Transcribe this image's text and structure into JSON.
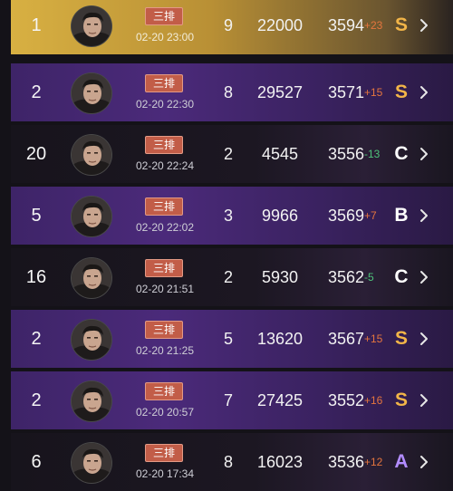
{
  "colors": {
    "delta_up": "#e4753e",
    "delta_down": "#4ec27a",
    "grade_S": "#f2b548",
    "grade_C": "#ffffff",
    "grade_B": "#ffffff",
    "grade_A": "#b28cff"
  },
  "rows": [
    {
      "rank": "1",
      "mode": "三排",
      "time": "02-20 23:00",
      "placement": "9",
      "score": "22000",
      "rating": "3594",
      "delta": "+23",
      "delta_sign": "up",
      "grade": "S",
      "style": "gold"
    },
    {
      "rank": "2",
      "mode": "三排",
      "time": "02-20 22:30",
      "placement": "8",
      "score": "29527",
      "rating": "3571",
      "delta": "+15",
      "delta_sign": "up",
      "grade": "S",
      "style": "purple"
    },
    {
      "rank": "20",
      "mode": "三排",
      "time": "02-20 22:24",
      "placement": "2",
      "score": "4545",
      "rating": "3556",
      "delta": "-13",
      "delta_sign": "down",
      "grade": "C",
      "style": "dark"
    },
    {
      "rank": "5",
      "mode": "三排",
      "time": "02-20 22:02",
      "placement": "3",
      "score": "9966",
      "rating": "3569",
      "delta": "+7",
      "delta_sign": "up",
      "grade": "B",
      "style": "purple"
    },
    {
      "rank": "16",
      "mode": "三排",
      "time": "02-20 21:51",
      "placement": "2",
      "score": "5930",
      "rating": "3562",
      "delta": "-5",
      "delta_sign": "down",
      "grade": "C",
      "style": "dark"
    },
    {
      "rank": "2",
      "mode": "三排",
      "time": "02-20 21:25",
      "placement": "5",
      "score": "13620",
      "rating": "3567",
      "delta": "+15",
      "delta_sign": "up",
      "grade": "S",
      "style": "purple"
    },
    {
      "rank": "2",
      "mode": "三排",
      "time": "02-20 20:57",
      "placement": "7",
      "score": "27425",
      "rating": "3552",
      "delta": "+16",
      "delta_sign": "up",
      "grade": "S",
      "style": "purple"
    },
    {
      "rank": "6",
      "mode": "三排",
      "time": "02-20 17:34",
      "placement": "8",
      "score": "16023",
      "rating": "3536",
      "delta": "+12",
      "delta_sign": "up",
      "grade": "A",
      "style": "dark"
    }
  ]
}
